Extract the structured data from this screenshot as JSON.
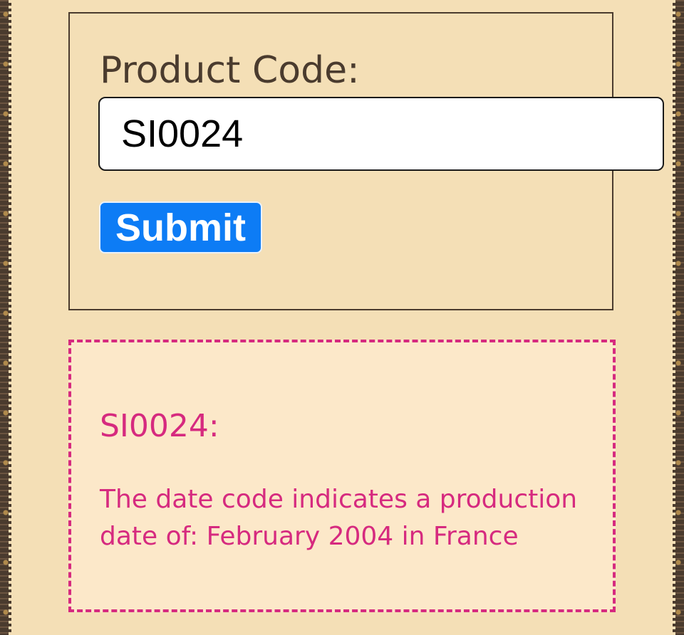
{
  "form": {
    "label": "Product Code:",
    "input_value": "SI0024",
    "submit_label": "Submit"
  },
  "result": {
    "code_heading": "SI0024:",
    "message": "The date code indicates a production date of: February 2004 in France"
  },
  "colors": {
    "background": "#f4dfb6",
    "border_dark": "#4a3b2e",
    "submit_blue": "#0d7cf5",
    "result_pink": "#d62a7f",
    "result_background": "#fce8c9"
  }
}
